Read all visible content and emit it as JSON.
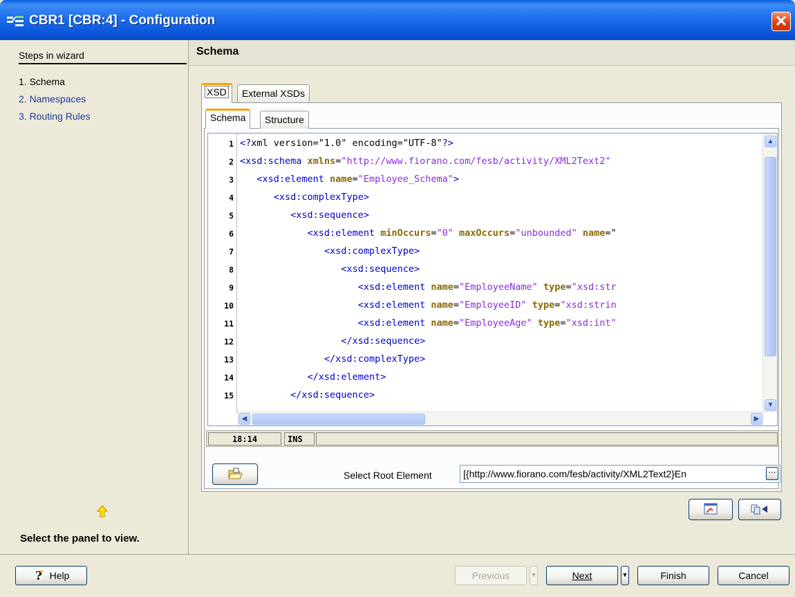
{
  "window": {
    "title": "CBR1 [CBR:4] - Configuration",
    "close_glyph": "✕"
  },
  "wizard": {
    "header": "Steps in wizard",
    "steps": [
      {
        "label": "1. Schema",
        "active": true
      },
      {
        "label": "2. Namespaces",
        "active": false
      },
      {
        "label": "3. Routing Rules",
        "active": false
      }
    ],
    "hint": "Select the panel to view."
  },
  "panel": {
    "title": "Schema",
    "outer_tabs": [
      "XSD",
      "External XSDs"
    ],
    "inner_tabs": [
      "Schema",
      "Structure"
    ]
  },
  "editor": {
    "line_numbers": [
      "1",
      "2",
      "3",
      "4",
      "5",
      "6",
      "7",
      "8",
      "9",
      "10",
      "11",
      "12",
      "13",
      "14",
      "15"
    ],
    "status_position": "18:14",
    "status_mode": "INS"
  },
  "root_element": {
    "label": "Select Root Element",
    "value": "[{http://www.fiorano.com/fesb/activity/XML2Text2}En"
  },
  "footer": {
    "help": "Help",
    "previous": "Previous",
    "next": "Next",
    "finish": "Finish",
    "cancel": "Cancel"
  },
  "colors": {
    "title_bar": "#1e6ef0",
    "tag": "#0000cc",
    "attribute": "#8b6a00",
    "value": "#8a2be2",
    "tab_highlight": "#f8a000"
  }
}
